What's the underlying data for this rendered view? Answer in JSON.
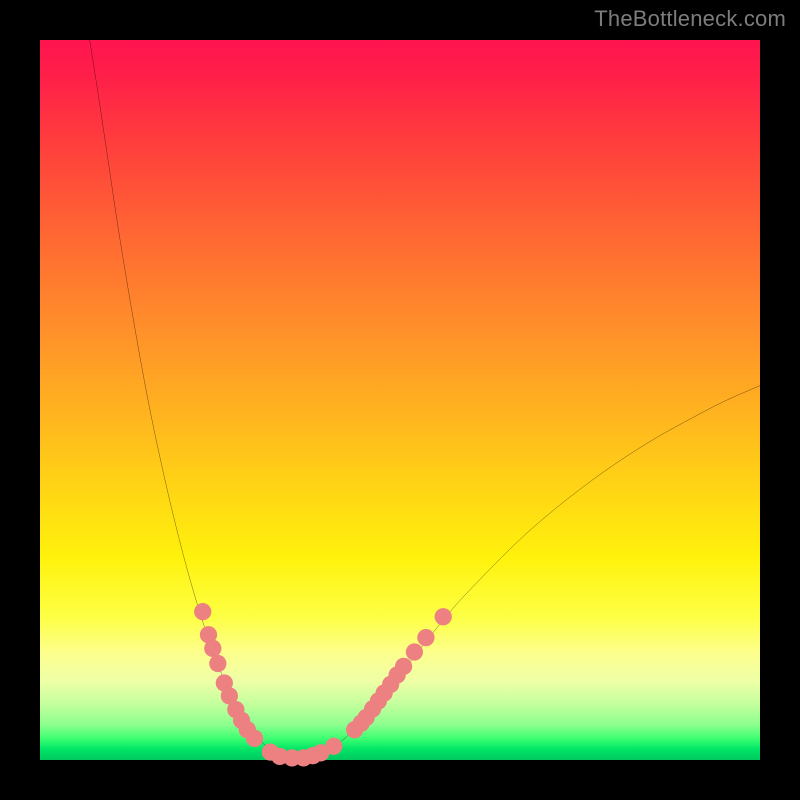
{
  "watermark": "TheBottleneck.com",
  "chart_data": {
    "type": "line",
    "title": "",
    "xlabel": "",
    "ylabel": "",
    "xlim": [
      0,
      100
    ],
    "ylim": [
      0,
      100
    ],
    "grid": false,
    "curve": {
      "name": "bottleneck-curve",
      "color": "#000000",
      "points": [
        {
          "x": 6.9,
          "y": 100.0
        },
        {
          "x": 8.0,
          "y": 93.0
        },
        {
          "x": 9.5,
          "y": 83.0
        },
        {
          "x": 11.0,
          "y": 73.0
        },
        {
          "x": 13.0,
          "y": 61.0
        },
        {
          "x": 15.0,
          "y": 50.0
        },
        {
          "x": 17.0,
          "y": 40.5
        },
        {
          "x": 19.0,
          "y": 32.0
        },
        {
          "x": 21.0,
          "y": 24.5
        },
        {
          "x": 23.0,
          "y": 18.0
        },
        {
          "x": 25.0,
          "y": 12.5
        },
        {
          "x": 27.0,
          "y": 8.0
        },
        {
          "x": 29.0,
          "y": 4.6
        },
        {
          "x": 31.0,
          "y": 2.3
        },
        {
          "x": 33.0,
          "y": 0.9
        },
        {
          "x": 35.0,
          "y": 0.3
        },
        {
          "x": 37.0,
          "y": 0.3
        },
        {
          "x": 39.0,
          "y": 0.9
        },
        {
          "x": 41.0,
          "y": 2.0
        },
        {
          "x": 43.0,
          "y": 3.6
        },
        {
          "x": 45.0,
          "y": 5.6
        },
        {
          "x": 47.0,
          "y": 8.0
        },
        {
          "x": 49.0,
          "y": 10.6
        },
        {
          "x": 52.0,
          "y": 14.4
        },
        {
          "x": 55.0,
          "y": 18.2
        },
        {
          "x": 58.0,
          "y": 21.8
        },
        {
          "x": 62.0,
          "y": 26.0
        },
        {
          "x": 66.0,
          "y": 30.0
        },
        {
          "x": 70.0,
          "y": 33.6
        },
        {
          "x": 75.0,
          "y": 37.6
        },
        {
          "x": 80.0,
          "y": 41.2
        },
        {
          "x": 85.0,
          "y": 44.4
        },
        {
          "x": 90.0,
          "y": 47.2
        },
        {
          "x": 95.0,
          "y": 49.8
        },
        {
          "x": 100.0,
          "y": 52.0
        }
      ]
    },
    "markers": {
      "name": "sample-points",
      "color": "#ed8181",
      "radius": 1.2,
      "points": [
        {
          "x": 22.6,
          "y": 20.6
        },
        {
          "x": 23.4,
          "y": 17.4
        },
        {
          "x": 24.0,
          "y": 15.5
        },
        {
          "x": 24.7,
          "y": 13.4
        },
        {
          "x": 25.6,
          "y": 10.7
        },
        {
          "x": 26.3,
          "y": 8.9
        },
        {
          "x": 27.2,
          "y": 7.0
        },
        {
          "x": 28.0,
          "y": 5.5
        },
        {
          "x": 28.8,
          "y": 4.2
        },
        {
          "x": 29.8,
          "y": 3.0
        },
        {
          "x": 32.0,
          "y": 1.1
        },
        {
          "x": 33.3,
          "y": 0.5
        },
        {
          "x": 35.0,
          "y": 0.3
        },
        {
          "x": 36.6,
          "y": 0.3
        },
        {
          "x": 37.9,
          "y": 0.6
        },
        {
          "x": 39.0,
          "y": 1.0
        },
        {
          "x": 40.8,
          "y": 1.9
        },
        {
          "x": 43.7,
          "y": 4.2
        },
        {
          "x": 44.6,
          "y": 5.1
        },
        {
          "x": 45.3,
          "y": 5.9
        },
        {
          "x": 46.2,
          "y": 7.1
        },
        {
          "x": 47.0,
          "y": 8.2
        },
        {
          "x": 47.8,
          "y": 9.3
        },
        {
          "x": 48.7,
          "y": 10.5
        },
        {
          "x": 49.6,
          "y": 11.8
        },
        {
          "x": 50.5,
          "y": 13.0
        },
        {
          "x": 52.0,
          "y": 15.0
        },
        {
          "x": 53.6,
          "y": 17.0
        },
        {
          "x": 56.0,
          "y": 19.9
        }
      ]
    }
  }
}
